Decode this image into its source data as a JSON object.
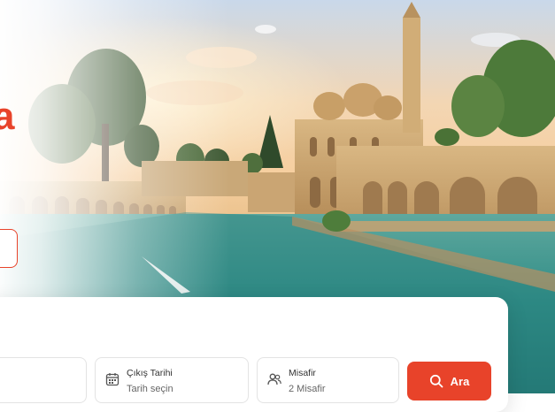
{
  "hero": {
    "title_fragment": "a",
    "image_description_icon": "landscape-photo"
  },
  "search": {
    "checkout_label": "Çıkış Tarihi",
    "checkout_value": "Tarih seçin",
    "guests_label": "Misafir",
    "guests_value": "2 Misafir",
    "search_button_label": "Ara"
  },
  "colors": {
    "accent": "#e8432a"
  }
}
